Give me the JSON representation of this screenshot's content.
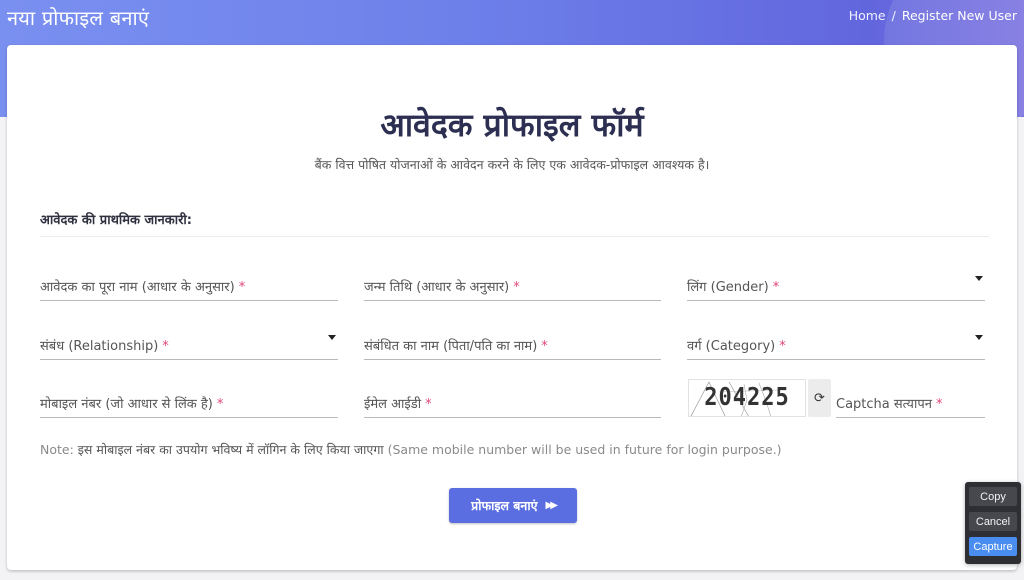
{
  "header": {
    "title": "नया प्रोफाइल बनाएं",
    "breadcrumb": {
      "home": "Home",
      "separator": "/",
      "current": "Register New User"
    }
  },
  "form": {
    "title": "आवेदक प्रोफाइल फॉर्म",
    "subtitle": "बैंक वित्त पोषित योजनाओं के आवेदन करने के लिए एक आवेदक-प्रोफाइल आवश्यक है।",
    "section_heading": "आवेदक की प्राथमिक जानकारी:",
    "required_mark": "*",
    "fields": {
      "full_name": {
        "label": "आवेदक का पूरा नाम (आधार के अनुसार)",
        "value": "",
        "type": "text"
      },
      "dob": {
        "label": "जन्म तिथि (आधार के अनुसार)",
        "value": "",
        "type": "date"
      },
      "gender": {
        "label": "लिंग (Gender)",
        "value": "",
        "type": "select"
      },
      "relationship": {
        "label": "संबंध (Relationship)",
        "value": "",
        "type": "select"
      },
      "relative_name": {
        "label": "संबंधित का नाम (पिता/पति का नाम)",
        "value": "",
        "type": "text"
      },
      "category": {
        "label": "वर्ग (Category)",
        "value": "",
        "type": "select"
      },
      "mobile": {
        "label": "मोबाइल नंबर (जो आधार से लिंक है)",
        "value": "",
        "type": "tel"
      },
      "email": {
        "label": "ईमेल आईडी",
        "value": "",
        "type": "email"
      },
      "captcha": {
        "label": "Captcha सत्यापन",
        "value": "",
        "type": "text"
      }
    },
    "captcha_code": "204225",
    "refresh_icon": "refresh-icon",
    "note": {
      "prefix": "Note:",
      "hindi": "इस मोबाइल नंबर का उपयोग भविष्य में लॉगिन के लिए किया जाएगा",
      "english": "(Same mobile number will be used in future for login purpose.)"
    },
    "submit_label": "प्रोफाइल बनाएं",
    "submit_icon": "double-chevron-right-icon"
  },
  "capture_tool": {
    "copy": "Copy",
    "cancel": "Cancel",
    "capture": "Capture"
  },
  "colors": {
    "accent": "#5b6ee1",
    "header_gradient_start": "#7a90f0",
    "header_gradient_end": "#6266dd",
    "title_text": "#2c2f52",
    "required": "#e0457b",
    "capture_primary": "#4a8df0"
  }
}
